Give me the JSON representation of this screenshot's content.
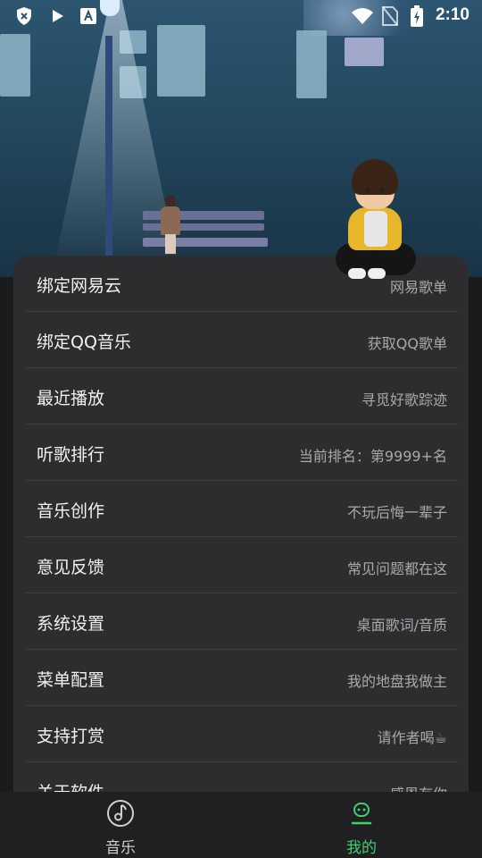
{
  "status_bar": {
    "time": "2:10",
    "icons": [
      "shield-x-icon",
      "play-icon",
      "a-badge-icon",
      "wifi-icon",
      "no-sim-icon",
      "battery-charging-icon"
    ]
  },
  "menu": {
    "items": [
      {
        "label": "绑定网易云",
        "sub": "网易歌单"
      },
      {
        "label": "绑定QQ音乐",
        "sub": "获取QQ歌单"
      },
      {
        "label": "最近播放",
        "sub": "寻觅好歌踪迹"
      },
      {
        "label": "听歌排行",
        "sub": "当前排名：第9999+名"
      },
      {
        "label": "音乐创作",
        "sub": "不玩后悔一辈子"
      },
      {
        "label": "意见反馈",
        "sub": "常见问题都在这"
      },
      {
        "label": "系统设置",
        "sub": "桌面歌词/音质"
      },
      {
        "label": "菜单配置",
        "sub": "我的地盘我做主"
      },
      {
        "label": "支持打赏",
        "sub": "请作者喝☕"
      },
      {
        "label": "关于软件",
        "sub": "感恩有你"
      }
    ]
  },
  "bottom_nav": {
    "tabs": [
      {
        "label": "音乐",
        "icon": "music-note-icon",
        "active": false
      },
      {
        "label": "我的",
        "icon": "person-icon",
        "active": true
      }
    ]
  },
  "colors": {
    "accent": "#3ecf6e",
    "inactive": "#cfcfcf",
    "card": "#2d2d30",
    "background": "#1b1b1d"
  }
}
